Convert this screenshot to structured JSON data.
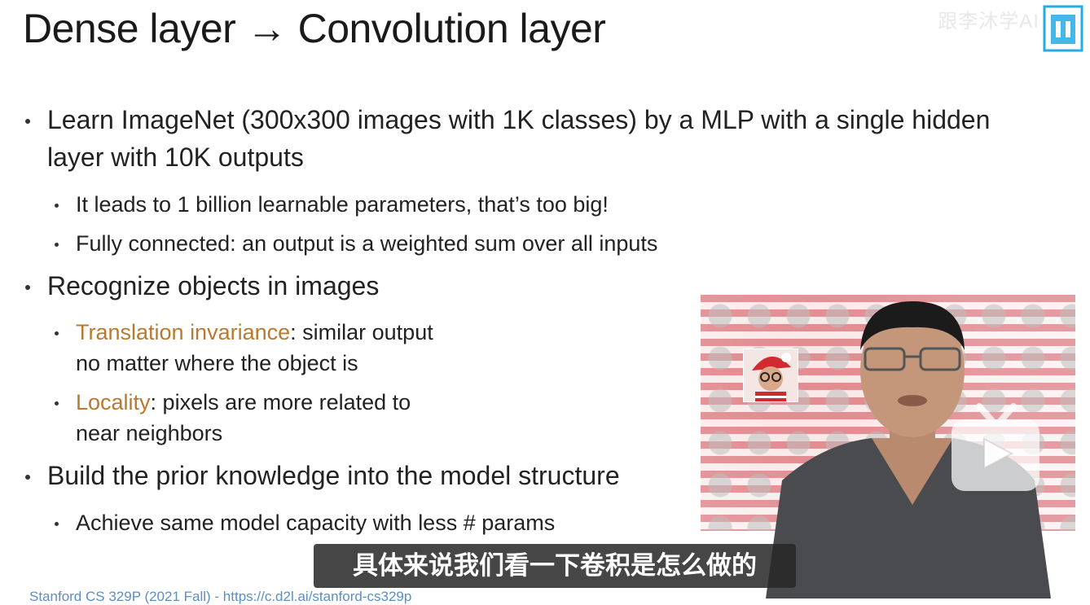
{
  "slide": {
    "title": "Dense layer → Convolution layer",
    "watermark": "跟李沐学AI",
    "bullets": {
      "l1_a": "Learn ImageNet (300x300 images with 1K classes) by a MLP with a single hidden",
      "l1_b": "layer with 10K outputs",
      "l2_a": "It leads to 1 billion learnable parameters, that’s too big!",
      "l2_b": "Fully connected: an output is a weighted sum over all inputs",
      "l3": "Recognize objects in images",
      "l4_hl": "Translation invariance",
      "l4_rest": ": similar output",
      "l4_cont": "no matter where the object is",
      "l5_hl": "Locality",
      "l5_rest": ": pixels are more related to",
      "l5_cont": "near neighbors",
      "l6": "Build the prior knowledge into the model structure",
      "l7": "Achieve same model capacity with less # params"
    },
    "footer_link": "Stanford CS 329P (2021 Fall) - https://c.d2l.ai/stanford-cs329p"
  },
  "subtitle": "具体来说我们看一下卷积是怎么做的",
  "colors": {
    "highlight": "#b9792f",
    "bilibili_blue": "#23ade5",
    "link": "#5a8fc4"
  },
  "icons": {
    "logo": "bilibili-logo-icon",
    "play": "play-icon"
  }
}
